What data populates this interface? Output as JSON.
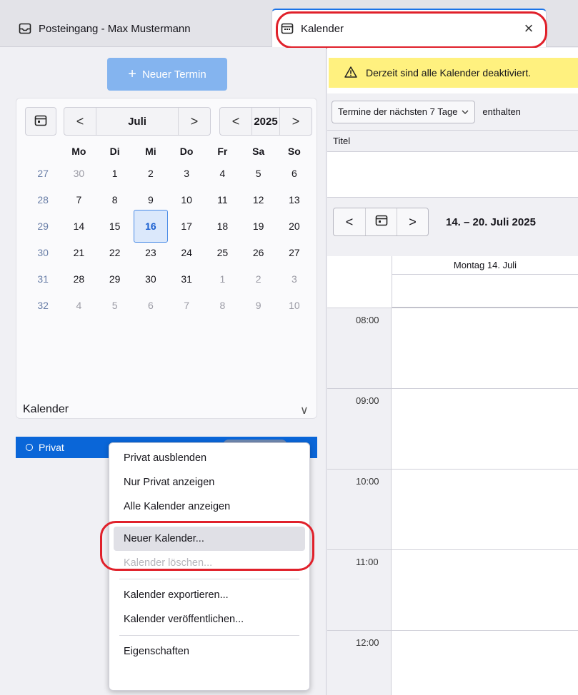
{
  "tabs": [
    {
      "label": "Posteingang - Max Mustermann",
      "icon": "inbox-icon"
    },
    {
      "label": "Kalender",
      "icon": "calendar-icon",
      "close": "×"
    }
  ],
  "sidebar": {
    "new_event_plus": "+",
    "new_event_label": "Neuer Termin",
    "minical": {
      "prev": "<",
      "next": ">",
      "month": "Juli",
      "year": "2025",
      "weekdays": [
        "Mo",
        "Di",
        "Mi",
        "Do",
        "Fr",
        "Sa",
        "So"
      ],
      "weeks": [
        {
          "wk": "27",
          "days": [
            "30",
            "1",
            "2",
            "3",
            "4",
            "5",
            "6"
          ]
        },
        {
          "wk": "28",
          "days": [
            "7",
            "8",
            "9",
            "10",
            "11",
            "12",
            "13"
          ]
        },
        {
          "wk": "29",
          "days": [
            "14",
            "15",
            "16",
            "17",
            "18",
            "19",
            "20"
          ]
        },
        {
          "wk": "30",
          "days": [
            "21",
            "22",
            "23",
            "24",
            "25",
            "26",
            "27"
          ]
        },
        {
          "wk": "31",
          "days": [
            "28",
            "29",
            "30",
            "31",
            "1",
            "2",
            "3"
          ]
        },
        {
          "wk": "32",
          "days": [
            "4",
            "5",
            "6",
            "7",
            "8",
            "9",
            "10"
          ]
        }
      ],
      "today": "16"
    },
    "calendars_title": "Kalender",
    "calendars_chevron": "∨",
    "calendars": [
      {
        "name": "Privat"
      }
    ]
  },
  "context_menu": {
    "items": [
      {
        "label": "Privat ausblenden"
      },
      {
        "label": "Nur Privat anzeigen"
      },
      {
        "label": "Alle Kalender anzeigen"
      },
      {
        "sep": true
      },
      {
        "label": "Neuer Kalender...",
        "state": "hover"
      },
      {
        "label": "Kalender löschen...",
        "state": "disabled"
      },
      {
        "sep": true
      },
      {
        "label": "Kalender exportieren..."
      },
      {
        "label": "Kalender veröffentlichen..."
      },
      {
        "sep": true
      },
      {
        "label": "Eigenschaften"
      }
    ]
  },
  "main": {
    "notification": "Derzeit sind alle Kalender deaktiviert.",
    "filter_select": "Termine der nächsten 7 Tage",
    "filter_text": "enthalten",
    "list_col_title": "Titel",
    "week_prev": "<",
    "week_next": ">",
    "week_label": "14. – 20. Juli 2025",
    "day_header": "Montag 14. Juli",
    "hours": [
      "08:00",
      "09:00",
      "10:00",
      "11:00",
      "12:00"
    ]
  },
  "colors": {
    "accent": "#0a66d8",
    "highlight_ring": "#e0202a",
    "notification_bg": "#fff17f"
  }
}
